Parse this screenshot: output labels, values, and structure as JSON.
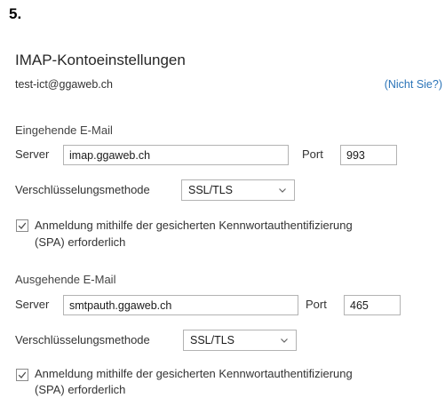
{
  "step": {
    "number": "5."
  },
  "dialog": {
    "title": "IMAP-Kontoeinstellungen",
    "account_email": "test-ict@ggaweb.ch",
    "not_you_link": "(Nicht Sie?)"
  },
  "incoming": {
    "heading": "Eingehende E-Mail",
    "server_label": "Server",
    "server_value": "imap.ggaweb.ch",
    "port_label": "Port",
    "port_value": "993",
    "encryption_label": "Verschlüsselungsmethode",
    "encryption_value": "SSL/TLS",
    "spa_checked": true,
    "spa_line1": "Anmeldung mithilfe der gesicherten Kennwortauthentifizierung",
    "spa_line2": "(SPA) erforderlich"
  },
  "outgoing": {
    "heading": "Ausgehende E-Mail",
    "server_label": "Server",
    "server_value": "smtpauth.ggaweb.ch",
    "port_label": "Port",
    "port_value": "465",
    "encryption_label": "Verschlüsselungsmethode",
    "encryption_value": "SSL/TLS",
    "spa_checked": true,
    "spa_line1": "Anmeldung mithilfe der gesicherten Kennwortauthentifizierung",
    "spa_line2": "(SPA) erforderlich"
  },
  "icons": {
    "dropdown": "chevron-down-icon",
    "checkbox": "checkmark-icon"
  },
  "colors": {
    "link": "#2b74b8",
    "border": "#b3b3b3",
    "text": "#333333"
  }
}
